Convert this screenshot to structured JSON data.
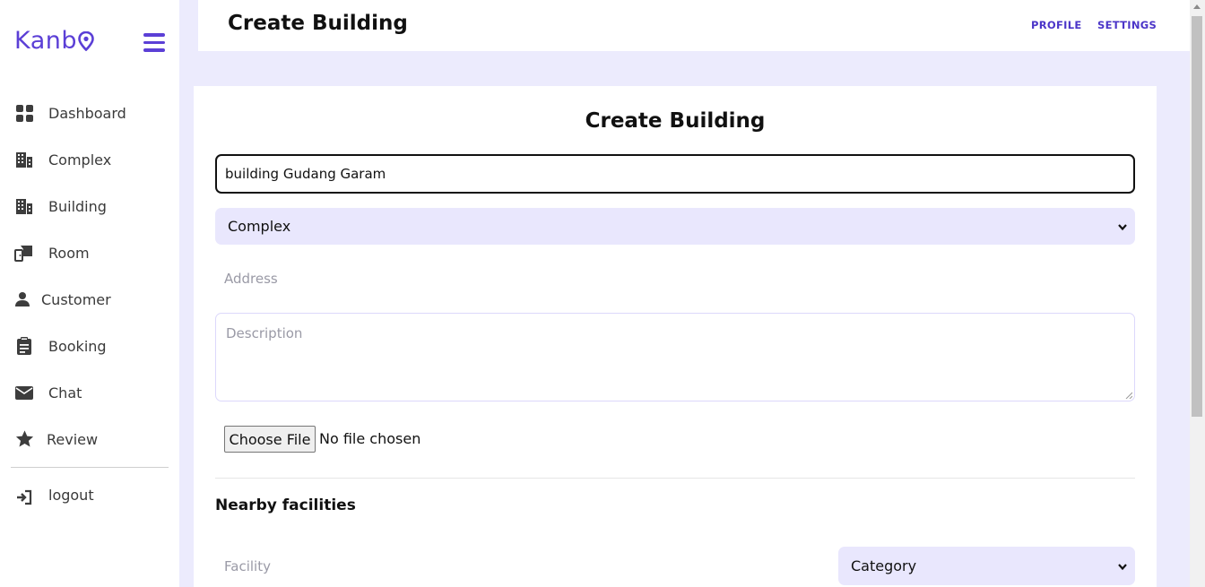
{
  "sidebar": {
    "brand": "Kanb",
    "items": [
      {
        "label": "Dashboard",
        "icon": "dashboard-icon"
      },
      {
        "label": "Complex",
        "icon": "building-icon"
      },
      {
        "label": "Building",
        "icon": "building-icon"
      },
      {
        "label": "Room",
        "icon": "room-icon"
      },
      {
        "label": "Customer",
        "icon": "user-icon"
      },
      {
        "label": "Booking",
        "icon": "clipboard-icon"
      },
      {
        "label": "Chat",
        "icon": "envelope-icon"
      },
      {
        "label": "Review",
        "icon": "star-icon"
      }
    ],
    "logout": "logout"
  },
  "header": {
    "title": "Create Building",
    "profile": "PROFILE",
    "settings": "SETTINGS"
  },
  "form": {
    "title": "Create Building",
    "name_value": "building Gudang Garam",
    "complex_select": "Complex",
    "address_placeholder": "Address",
    "description_placeholder": "Description",
    "file_button": "Choose File",
    "file_status": "No file chosen",
    "nearby_title": "Nearby facilities",
    "facility_placeholder": "Facility",
    "category_select": "Category"
  },
  "colors": {
    "accent": "#5b3fd6",
    "background": "#ecebfd",
    "select_bg": "#e9e7fd"
  }
}
